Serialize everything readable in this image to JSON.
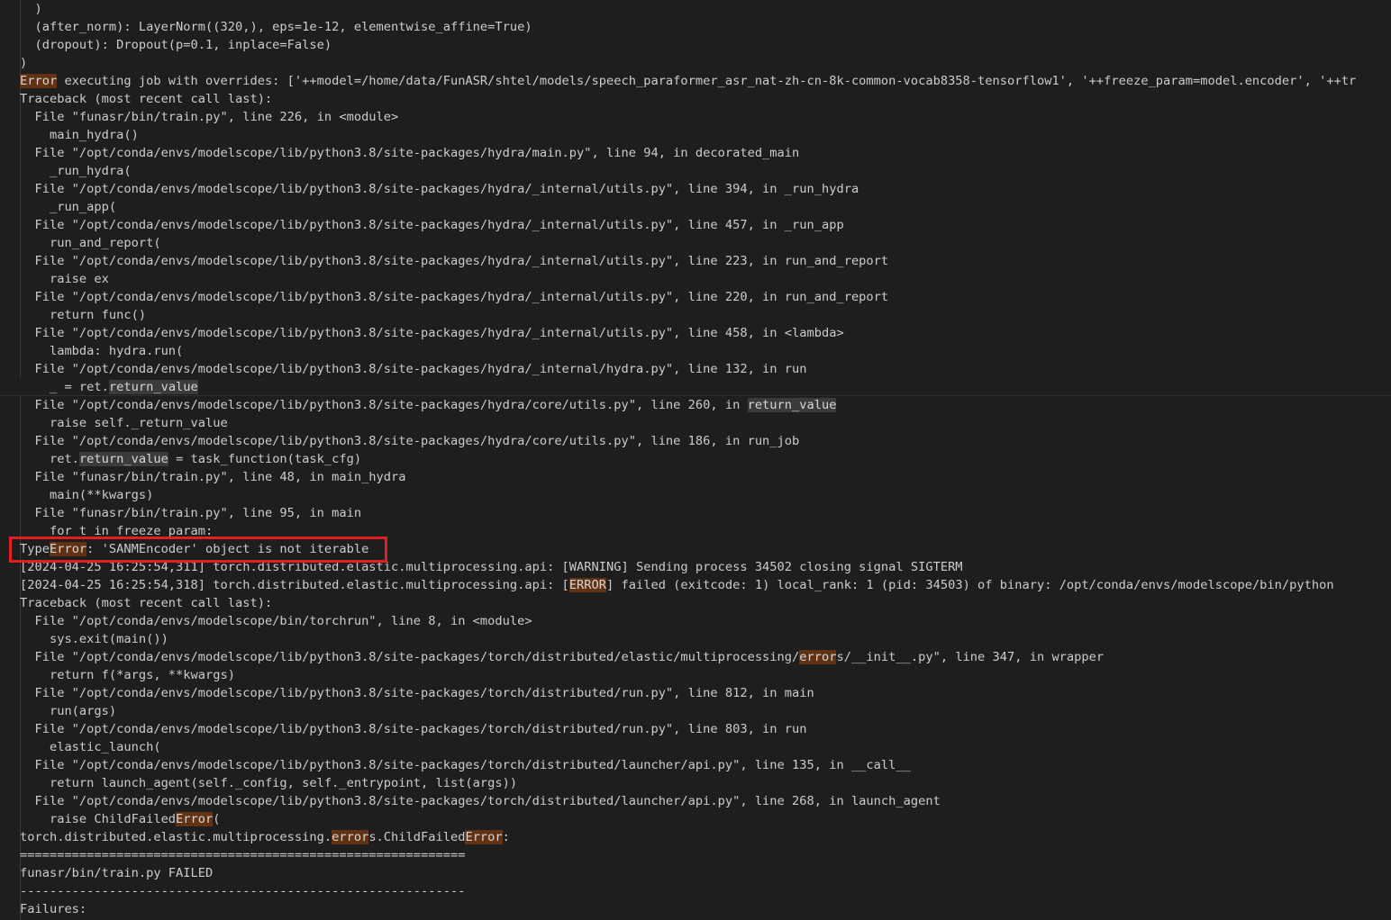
{
  "terminal": {
    "lines": [
      {
        "segments": [
          {
            "t": "  )"
          }
        ]
      },
      {
        "segments": [
          {
            "t": "  (after_norm): LayerNorm((320,), eps=1e-12, elementwise_affine=True)"
          }
        ]
      },
      {
        "segments": [
          {
            "t": "  (dropout): Dropout(p=0.1, inplace=False)"
          }
        ]
      },
      {
        "segments": [
          {
            "t": ")"
          }
        ]
      },
      {
        "segments": [
          {
            "t": "Error",
            "h": "find"
          },
          {
            "t": " executing job with overrides: ['++model=/home/data/FunASR/shtel/models/speech_paraformer_asr_nat-zh-cn-8k-common-vocab8358-tensorflow1', '++freeze_param=model.encoder', '++tr"
          }
        ]
      },
      {
        "segments": [
          {
            "t": "Traceback (most recent call last):"
          }
        ]
      },
      {
        "segments": [
          {
            "t": "  File \"funasr/bin/train.py\", line 226, in <module>"
          }
        ]
      },
      {
        "segments": [
          {
            "t": "    main_hydra()"
          }
        ]
      },
      {
        "segments": [
          {
            "t": "  File \"/opt/conda/envs/modelscope/lib/python3.8/site-packages/hydra/main.py\", line 94, in decorated_main"
          }
        ]
      },
      {
        "segments": [
          {
            "t": "    _run_hydra("
          }
        ]
      },
      {
        "segments": [
          {
            "t": "  File \"/opt/conda/envs/modelscope/lib/python3.8/site-packages/hydra/_internal/utils.py\", line 394, in _run_hydra"
          }
        ]
      },
      {
        "segments": [
          {
            "t": "    _run_app("
          }
        ]
      },
      {
        "segments": [
          {
            "t": "  File \"/opt/conda/envs/modelscope/lib/python3.8/site-packages/hydra/_internal/utils.py\", line 457, in _run_app"
          }
        ]
      },
      {
        "segments": [
          {
            "t": "    run_and_report("
          }
        ]
      },
      {
        "segments": [
          {
            "t": "  File \"/opt/conda/envs/modelscope/lib/python3.8/site-packages/hydra/_internal/utils.py\", line 223, in run_and_report"
          }
        ]
      },
      {
        "segments": [
          {
            "t": "    raise ex"
          }
        ]
      },
      {
        "segments": [
          {
            "t": "  File \"/opt/conda/envs/modelscope/lib/python3.8/site-packages/hydra/_internal/utils.py\", line 220, in run_and_report"
          }
        ]
      },
      {
        "segments": [
          {
            "t": "    return func()"
          }
        ]
      },
      {
        "segments": [
          {
            "t": "  File \"/opt/conda/envs/modelscope/lib/python3.8/site-packages/hydra/_internal/utils.py\", line 458, in <lambda>"
          }
        ]
      },
      {
        "segments": [
          {
            "t": "    lambda: hydra.run("
          }
        ]
      },
      {
        "segments": [
          {
            "t": "  File \"/opt/conda/envs/modelscope/lib/python3.8/site-packages/hydra/_internal/hydra.py\", line 132, in run"
          }
        ]
      },
      {
        "current": true,
        "segments": [
          {
            "t": "    _ = ret."
          },
          {
            "t": "return_value",
            "h": "word"
          }
        ]
      },
      {
        "segments": [
          {
            "t": "  File \"/opt/conda/envs/modelscope/lib/python3.8/site-packages/hydra/core/utils.py\", line 260, in "
          },
          {
            "t": "return_value",
            "h": "word"
          }
        ]
      },
      {
        "segments": [
          {
            "t": "    raise self._return_value"
          }
        ]
      },
      {
        "segments": [
          {
            "t": "  File \"/opt/conda/envs/modelscope/lib/python3.8/site-packages/hydra/core/utils.py\", line 186, in run_job"
          }
        ]
      },
      {
        "segments": [
          {
            "t": "    ret."
          },
          {
            "t": "return_value",
            "h": "word"
          },
          {
            "t": " = task_function(task_cfg)"
          }
        ]
      },
      {
        "segments": [
          {
            "t": "  File \"funasr/bin/train.py\", line 48, in main_hydra"
          }
        ]
      },
      {
        "segments": [
          {
            "t": "    main(**kwargs)"
          }
        ]
      },
      {
        "segments": [
          {
            "t": "  File \"funasr/bin/train.py\", line 95, in main"
          }
        ]
      },
      {
        "segments": [
          {
            "t": "    for t in freeze_param:"
          }
        ]
      },
      {
        "segments": [
          {
            "t": "Type"
          },
          {
            "t": "Error",
            "h": "find"
          },
          {
            "t": ": 'SANMEncoder' object is not iterable"
          }
        ]
      },
      {
        "segments": [
          {
            "t": "[2024-04-25 16:25:54,311] torch.distributed.elastic.multiprocessing.api: [WARNING] Sending process 34502 closing signal SIGTERM"
          }
        ]
      },
      {
        "segments": [
          {
            "t": "[2024-04-25 16:25:54,318] torch.distributed.elastic.multiprocessing.api: ["
          },
          {
            "t": "ERROR",
            "h": "find"
          },
          {
            "t": "] failed (exitcode: 1) local_rank: 1 (pid: 34503) of binary: /opt/conda/envs/modelscope/bin/python"
          }
        ]
      },
      {
        "segments": [
          {
            "t": "Traceback (most recent call last):"
          }
        ]
      },
      {
        "segments": [
          {
            "t": "  File \"/opt/conda/envs/modelscope/bin/torchrun\", line 8, in <module>"
          }
        ]
      },
      {
        "segments": [
          {
            "t": "    sys.exit(main())"
          }
        ]
      },
      {
        "segments": [
          {
            "t": "  File \"/opt/conda/envs/modelscope/lib/python3.8/site-packages/torch/distributed/elastic/multiprocessing/"
          },
          {
            "t": "error",
            "h": "find"
          },
          {
            "t": "s/__init__.py\", line 347, in wrapper"
          }
        ]
      },
      {
        "segments": [
          {
            "t": "    return f(*args, **kwargs)"
          }
        ]
      },
      {
        "segments": [
          {
            "t": "  File \"/opt/conda/envs/modelscope/lib/python3.8/site-packages/torch/distributed/run.py\", line 812, in main"
          }
        ]
      },
      {
        "segments": [
          {
            "t": "    run(args)"
          }
        ]
      },
      {
        "segments": [
          {
            "t": "  File \"/opt/conda/envs/modelscope/lib/python3.8/site-packages/torch/distributed/run.py\", line 803, in run"
          }
        ]
      },
      {
        "segments": [
          {
            "t": "    elastic_launch("
          }
        ]
      },
      {
        "segments": [
          {
            "t": "  File \"/opt/conda/envs/modelscope/lib/python3.8/site-packages/torch/distributed/launcher/api.py\", line 135, in __call__"
          }
        ]
      },
      {
        "segments": [
          {
            "t": "    return launch_agent(self._config, self._entrypoint, list(args))"
          }
        ]
      },
      {
        "segments": [
          {
            "t": "  File \"/opt/conda/envs/modelscope/lib/python3.8/site-packages/torch/distributed/launcher/api.py\", line 268, in launch_agent"
          }
        ]
      },
      {
        "segments": [
          {
            "t": "    raise ChildFailed"
          },
          {
            "t": "Error",
            "h": "find"
          },
          {
            "t": "("
          }
        ]
      },
      {
        "segments": [
          {
            "t": "torch.distributed.elastic.multiprocessing."
          },
          {
            "t": "error",
            "h": "find"
          },
          {
            "t": "s.ChildFailed"
          },
          {
            "t": "Error",
            "h": "find"
          },
          {
            "t": ":"
          }
        ]
      },
      {
        "segments": [
          {
            "t": "============================================================"
          }
        ]
      },
      {
        "segments": [
          {
            "t": "funasr/bin/train.py FAILED"
          }
        ]
      },
      {
        "segments": [
          {
            "t": "------------------------------------------------------------"
          }
        ]
      },
      {
        "segments": [
          {
            "t": "Failures:"
          }
        ]
      }
    ]
  },
  "colors": {
    "background": "#1e1e1e",
    "text": "#cccccc",
    "find_highlight": "#613214",
    "word_highlight": "#3b3b3b",
    "annotation_box": "#e02020"
  }
}
